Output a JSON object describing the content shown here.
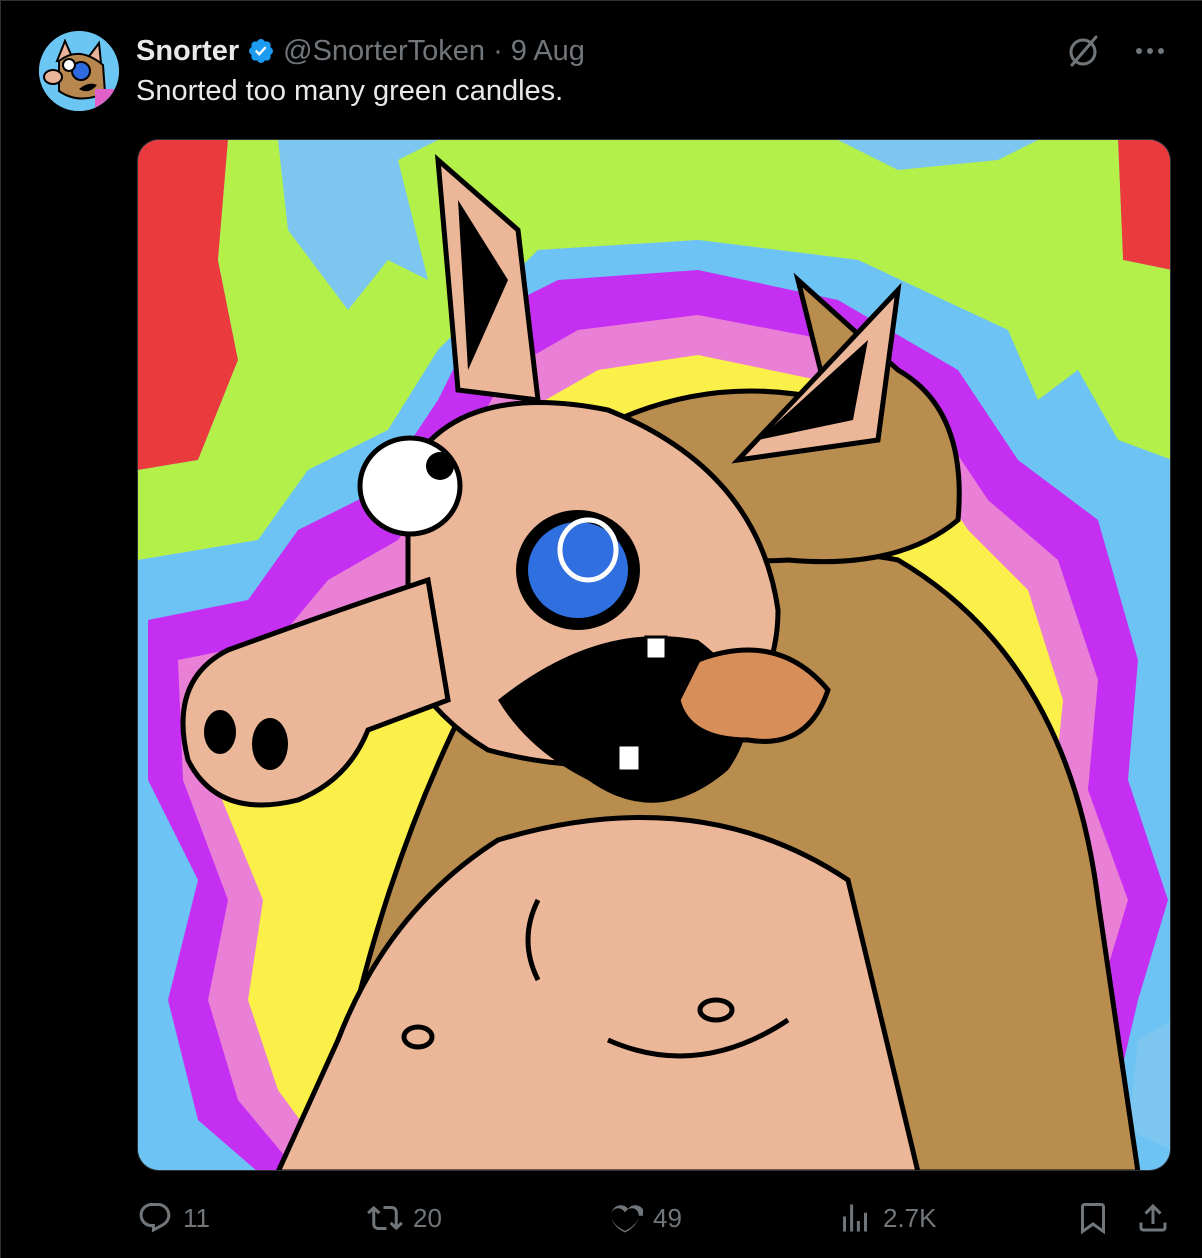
{
  "tweet": {
    "author_name": "Snorter",
    "handle": "@SnorterToken",
    "separator": "·",
    "date": "9 Aug",
    "text": "Snorted too many green candles."
  },
  "icons": {
    "verified": "verified-badge-icon",
    "grok": "grok-icon",
    "more": "more-icon",
    "reply": "reply-icon",
    "retweet": "retweet-icon",
    "like": "heart-icon",
    "views": "views-icon",
    "bookmark": "bookmark-icon",
    "share": "share-icon"
  },
  "stats": {
    "replies": "11",
    "retweets": "20",
    "likes": "49",
    "views": "2.7K"
  },
  "colors": {
    "background": "#000000",
    "text": "#e7e9ea",
    "muted": "#71767b",
    "verified": "#1d9bf0"
  }
}
